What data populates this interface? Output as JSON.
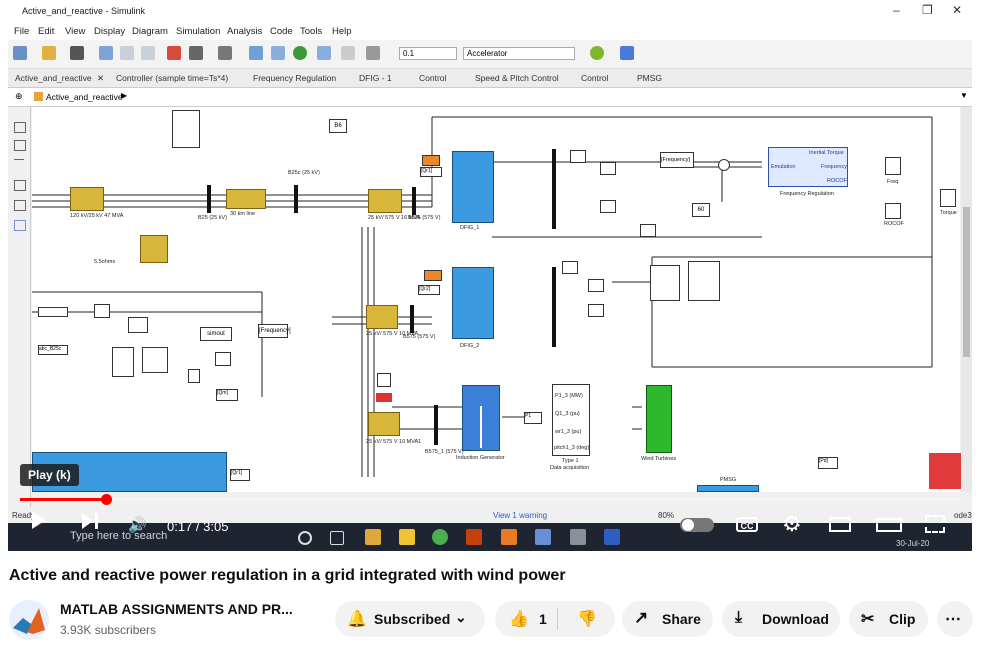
{
  "simulink": {
    "window_title": "Active_and_reactive - Simulink",
    "window_buttons": [
      "–",
      "❐",
      "✕"
    ],
    "menu": [
      "File",
      "Edit",
      "View",
      "Display",
      "Diagram",
      "Simulation",
      "Analysis",
      "Code",
      "Tools",
      "Help"
    ],
    "stop_time": "0.1",
    "solver_mode": "Accelerator",
    "tabs": [
      "Active_and_reactive",
      "Controller (sample time=Ts*4)",
      "Frequency Regulation",
      "DFIG - 1",
      "Control",
      "Speed & Pitch Control",
      "Control",
      "PMSG"
    ],
    "breadcrumb": "Active_and_reactive",
    "status": {
      "left": "Ready",
      "center": "View 1 warning",
      "zoom": "80%",
      "right": "ode3"
    },
    "diagram": {
      "blocks": {
        "b1": "B6",
        "freq_ctrl": "[Frequency]",
        "freq_reg_in1": "Emulation",
        "freq_reg_out1": "Inertial Torque",
        "freq_reg_out2": "Frequency",
        "freq_reg_out3": "ROCOF",
        "freq_reg_name": "Frequency Regulation",
        "scope_freq": "Freq",
        "scope_torque": "Torque",
        "scope_rocof": "ROCOF",
        "const60": "60",
        "tr1": "120 kV/25 kV\n47 MVA",
        "b25": "B25\n(25 kV)",
        "line30": "30 km line",
        "b25c": "B25c\n(25 kV)",
        "tr2": "25 kV/ 575 V\n16 MVA",
        "b575": "B575\n(575 V)",
        "dfig1": "DFIG_1",
        "dfig2": "DFIG_2",
        "tr3": "25 kV/ 575 V\n10 MVA",
        "tr4": "25 kV/ 575 V\n10 MVA1",
        "b575_1": "B575_1\n(575 V)",
        "b575b": "B575\n(575 V)",
        "ind_gen": "Induction Generator",
        "data_acq": "Data acquisition",
        "wind_turb": "Wind Turbines",
        "pmsg": "PMSG",
        "simout": "simout",
        "freq_tag": "[Frequency]",
        "qm_tag": "[Qm]",
        "abc_b25": "abc_B25c",
        "gen_tag": "5.5ohms",
        "pf": "[Pf]",
        "p_d": "[Pd]",
        "wind_in": "Wind (m/s)",
        "type1": "Type 1",
        "cur1": "P1_3 (MW)",
        "cur2": "Q1_3 (pu)",
        "cur3": "wr1_3 (pu)",
        "cur4": "pitch1_3 (deg)"
      }
    }
  },
  "player": {
    "tooltip": "Play (k)",
    "time": "0:17 / 3:05",
    "progress": 0.092,
    "taskbar_search": "Type here to search",
    "taskbar_clock": "30-Jul-20"
  },
  "video": {
    "title": "Active and reactive power regulation in a grid integrated with wind power",
    "channel": "MATLAB ASSIGNMENTS AND PR...",
    "subscribers": "3.93K subscribers",
    "subscribe_label": "Subscribed",
    "like_count": "1",
    "share_label": "Share",
    "download_label": "Download",
    "clip_label": "Clip"
  },
  "colors": {
    "progress": "#ff0000",
    "pill_bg": "#f2f2f2",
    "block_blue": "#3b9ae0",
    "transformer": "#d8b63a"
  }
}
